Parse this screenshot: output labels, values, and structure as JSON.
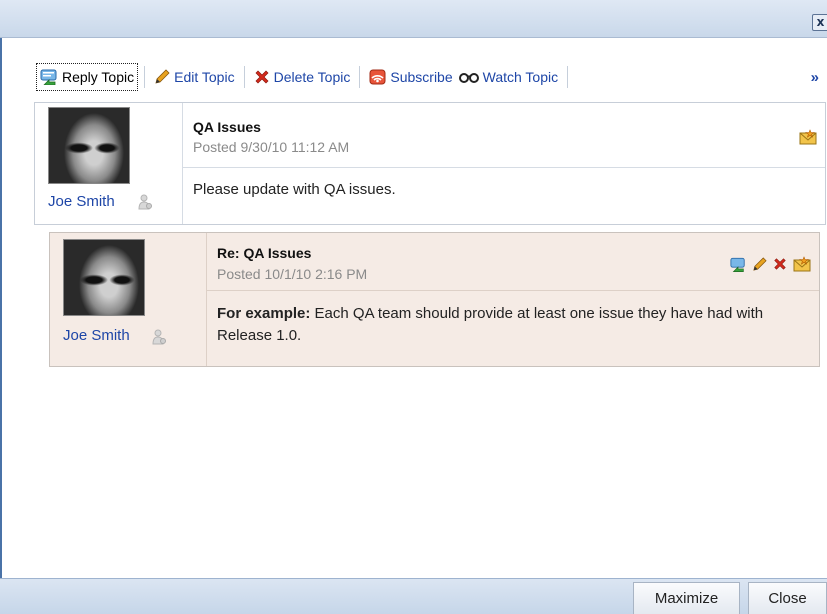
{
  "window": {
    "close_glyph": "x"
  },
  "toolbar": {
    "reply_topic": "Reply Topic",
    "edit_topic": "Edit Topic",
    "delete_topic": "Delete Topic",
    "subscribe": "Subscribe",
    "watch_topic": "Watch Topic",
    "overflow": "»"
  },
  "posts": [
    {
      "title": "QA Issues",
      "posted": "Posted 9/30/10 11:12 AM",
      "author": "Joe Smith",
      "body": "Please update with QA issues.",
      "icons": [
        "subscribe-envelope-icon"
      ]
    },
    {
      "title": "Re: QA Issues",
      "posted": "Posted 10/1/10 2:16 PM",
      "author": "Joe Smith",
      "body_bold": "For example:",
      "body": " Each QA team should provide at least one issue they have had with Release 1.0.",
      "icons": [
        "reply-icon",
        "edit-pencil-icon",
        "delete-x-icon",
        "subscribe-envelope-icon"
      ]
    }
  ],
  "footer": {
    "maximize": "Maximize",
    "close": "Close"
  },
  "colors": {
    "link": "#1e46a7",
    "titlebar": "#c9d8ea",
    "reply_background": "#f5ebe5",
    "date_text": "#8a8a8a"
  }
}
